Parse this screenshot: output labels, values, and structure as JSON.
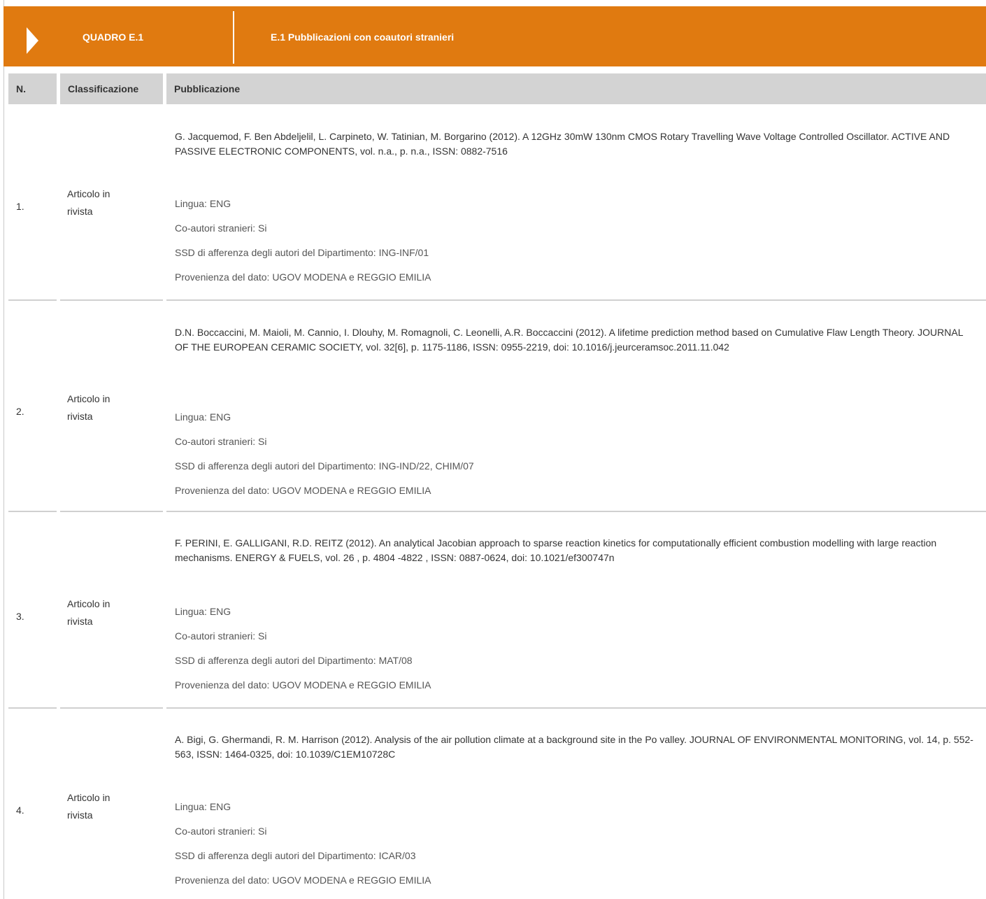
{
  "header": {
    "code": "QUADRO E.1",
    "title": "E.1 Pubblicazioni con coautori stranieri"
  },
  "columns": {
    "n": "N.",
    "classification": "Classificazione",
    "publication": "Pubblicazione"
  },
  "rows": [
    {
      "n": "1.",
      "classification_line1": "Articolo in",
      "classification_line2": "rivista",
      "citation": "G. Jacquemod, F. Ben Abdeljelil, L. Carpineto, W. Tatinian, M. Borgarino (2012). A 12GHz 30mW 130nm CMOS Rotary Travelling Wave Voltage Controlled Oscillator. ACTIVE AND PASSIVE ELECTRONIC COMPONENTS, vol. n.a., p. n.a., ISSN: 0882-7516",
      "lingua": "Lingua: ENG",
      "coautori": "Co-autori stranieri: Si",
      "ssd": "SSD di afferenza degli autori del Dipartimento: ING-INF/01",
      "provenienza": "Provenienza del dato: UGOV MODENA e REGGIO EMILIA"
    },
    {
      "n": "2.",
      "classification_line1": "Articolo in",
      "classification_line2": "rivista",
      "citation": "D.N. Boccaccini, M. Maioli, M. Cannio, I. Dlouhy, M. Romagnoli, C. Leonelli, A.R. Boccaccini (2012). A lifetime prediction method based on Cumulative Flaw Length Theory. JOURNAL OF THE EUROPEAN CERAMIC SOCIETY, vol. 32[6], p. 1175-1186, ISSN: 0955-2219, doi: 10.1016/j.jeurceramsoc.2011.11.042",
      "lingua": "Lingua: ENG",
      "coautori": "Co-autori stranieri: Si",
      "ssd": "SSD di afferenza degli autori del Dipartimento: ING-IND/22, CHIM/07",
      "provenienza": "Provenienza del dato: UGOV MODENA e REGGIO EMILIA"
    },
    {
      "n": "3.",
      "classification_line1": "Articolo in",
      "classification_line2": "rivista",
      "citation": "F. PERINI, E. GALLIGANI, R.D. REITZ (2012). An analytical Jacobian approach to sparse reaction kinetics for computationally efficient combustion modelling with large reaction mechanisms. ENERGY & FUELS, vol. 26 , p. 4804 -4822 , ISSN: 0887-0624, doi: 10.1021/ef300747n",
      "lingua": "Lingua: ENG",
      "coautori": "Co-autori stranieri: Si",
      "ssd": "SSD di afferenza degli autori del Dipartimento: MAT/08",
      "provenienza": "Provenienza del dato: UGOV MODENA e REGGIO EMILIA"
    },
    {
      "n": "4.",
      "classification_line1": "Articolo in",
      "classification_line2": "rivista",
      "citation": "A. Bigi, G. Ghermandi, R. M. Harrison (2012). Analysis of the air pollution climate at a background site in the Po valley. JOURNAL OF ENVIRONMENTAL MONITORING, vol. 14, p. 552-563, ISSN: 1464-0325, doi: 10.1039/C1EM10728C",
      "lingua": "Lingua: ENG",
      "coautori": "Co-autori stranieri: Si",
      "ssd": "SSD di afferenza degli autori del Dipartimento: ICAR/03",
      "provenienza": "Provenienza del dato: UGOV MODENA e REGGIO EMILIA"
    }
  ]
}
